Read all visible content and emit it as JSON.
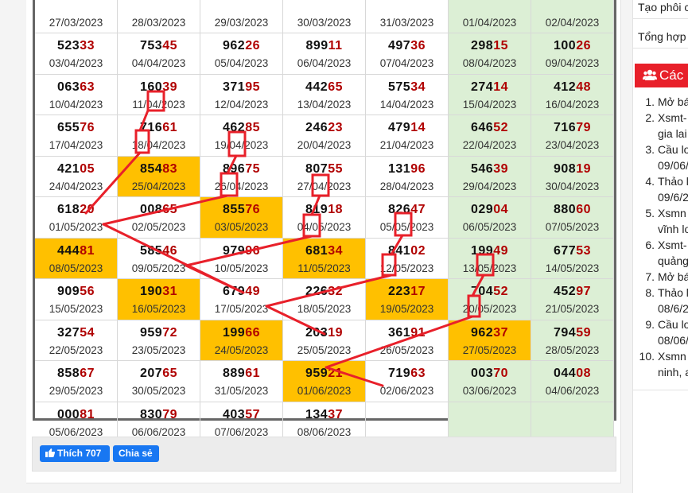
{
  "results_table": {
    "rows": [
      [
        {
          "head": "",
          "tail": "",
          "date": "27/03/2023"
        },
        {
          "head": "",
          "tail": "",
          "date": "28/03/2023"
        },
        {
          "head": "",
          "tail": "",
          "date": "29/03/2023"
        },
        {
          "head": "",
          "tail": "",
          "date": "30/03/2023"
        },
        {
          "head": "",
          "tail": "",
          "date": "31/03/2023"
        },
        {
          "head": "",
          "tail": "",
          "date": "01/04/2023"
        },
        {
          "head": "",
          "tail": "",
          "date": "02/04/2023"
        }
      ],
      [
        {
          "head": "523",
          "tail": "33",
          "date": "03/04/2023"
        },
        {
          "head": "753",
          "tail": "45",
          "date": "04/04/2023"
        },
        {
          "head": "962",
          "tail": "26",
          "date": "05/04/2023"
        },
        {
          "head": "899",
          "tail": "11",
          "date": "06/04/2023"
        },
        {
          "head": "497",
          "tail": "36",
          "date": "07/04/2023"
        },
        {
          "head": "298",
          "tail": "15",
          "date": "08/04/2023"
        },
        {
          "head": "100",
          "tail": "26",
          "date": "09/04/2023"
        }
      ],
      [
        {
          "head": "063",
          "tail": "63",
          "date": "10/04/2023"
        },
        {
          "head": "160",
          "tail": "39",
          "date": "11/04/2023"
        },
        {
          "head": "371",
          "tail": "95",
          "date": "12/04/2023"
        },
        {
          "head": "442",
          "tail": "65",
          "date": "13/04/2023"
        },
        {
          "head": "575",
          "tail": "34",
          "date": "14/04/2023"
        },
        {
          "head": "274",
          "tail": "14",
          "date": "15/04/2023"
        },
        {
          "head": "412",
          "tail": "48",
          "date": "16/04/2023"
        }
      ],
      [
        {
          "head": "655",
          "tail": "76",
          "date": "17/04/2023"
        },
        {
          "head": "716",
          "tail": "61",
          "date": "18/04/2023"
        },
        {
          "head": "462",
          "tail": "85",
          "date": "19/04/2023"
        },
        {
          "head": "246",
          "tail": "23",
          "date": "20/04/2023"
        },
        {
          "head": "479",
          "tail": "14",
          "date": "21/04/2023"
        },
        {
          "head": "646",
          "tail": "52",
          "date": "22/04/2023"
        },
        {
          "head": "716",
          "tail": "79",
          "date": "23/04/2023"
        }
      ],
      [
        {
          "head": "421",
          "tail": "05",
          "date": "24/04/2023"
        },
        {
          "head": "854",
          "tail": "83",
          "date": "25/04/2023"
        },
        {
          "head": "896",
          "tail": "75",
          "date": "26/04/2023"
        },
        {
          "head": "807",
          "tail": "55",
          "date": "27/04/2023"
        },
        {
          "head": "131",
          "tail": "96",
          "date": "28/04/2023"
        },
        {
          "head": "546",
          "tail": "39",
          "date": "29/04/2023"
        },
        {
          "head": "908",
          "tail": "19",
          "date": "30/04/2023"
        }
      ],
      [
        {
          "head": "618",
          "tail": "20",
          "date": "01/05/2023"
        },
        {
          "head": "008",
          "tail": "65",
          "date": "02/05/2023"
        },
        {
          "head": "855",
          "tail": "76",
          "date": "03/05/2023"
        },
        {
          "head": "819",
          "tail": "18",
          "date": "04/05/2023"
        },
        {
          "head": "826",
          "tail": "47",
          "date": "05/05/2023"
        },
        {
          "head": "029",
          "tail": "04",
          "date": "06/05/2023"
        },
        {
          "head": "880",
          "tail": "60",
          "date": "07/05/2023"
        }
      ],
      [
        {
          "head": "444",
          "tail": "81",
          "date": "08/05/2023"
        },
        {
          "head": "585",
          "tail": "46",
          "date": "09/05/2023"
        },
        {
          "head": "979",
          "tail": "96",
          "date": "10/05/2023"
        },
        {
          "head": "681",
          "tail": "34",
          "date": "11/05/2023"
        },
        {
          "head": "841",
          "tail": "02",
          "date": "12/05/2023"
        },
        {
          "head": "199",
          "tail": "49",
          "date": "13/05/2023"
        },
        {
          "head": "677",
          "tail": "53",
          "date": "14/05/2023"
        }
      ],
      [
        {
          "head": "909",
          "tail": "56",
          "date": "15/05/2023"
        },
        {
          "head": "190",
          "tail": "31",
          "date": "16/05/2023"
        },
        {
          "head": "679",
          "tail": "49",
          "date": "17/05/2023"
        },
        {
          "head": "226",
          "tail": "32",
          "date": "18/05/2023"
        },
        {
          "head": "223",
          "tail": "17",
          "date": "19/05/2023"
        },
        {
          "head": "704",
          "tail": "52",
          "date": "20/05/2023"
        },
        {
          "head": "452",
          "tail": "97",
          "date": "21/05/2023"
        }
      ],
      [
        {
          "head": "327",
          "tail": "54",
          "date": "22/05/2023"
        },
        {
          "head": "959",
          "tail": "72",
          "date": "23/05/2023"
        },
        {
          "head": "199",
          "tail": "66",
          "date": "24/05/2023"
        },
        {
          "head": "203",
          "tail": "19",
          "date": "25/05/2023"
        },
        {
          "head": "361",
          "tail": "91",
          "date": "26/05/2023"
        },
        {
          "head": "962",
          "tail": "37",
          "date": "27/05/2023"
        },
        {
          "head": "794",
          "tail": "59",
          "date": "28/05/2023"
        }
      ],
      [
        {
          "head": "858",
          "tail": "67",
          "date": "29/05/2023"
        },
        {
          "head": "207",
          "tail": "65",
          "date": "30/05/2023"
        },
        {
          "head": "889",
          "tail": "61",
          "date": "31/05/2023"
        },
        {
          "head": "959",
          "tail": "21",
          "date": "01/06/2023"
        },
        {
          "head": "719",
          "tail": "63",
          "date": "02/06/2023"
        },
        {
          "head": "003",
          "tail": "70",
          "date": "03/06/2023"
        },
        {
          "head": "044",
          "tail": "08",
          "date": "04/06/2023"
        }
      ],
      [
        {
          "head": "000",
          "tail": "81",
          "date": "05/06/2023"
        },
        {
          "head": "830",
          "tail": "79",
          "date": "06/06/2023"
        },
        {
          "head": "403",
          "tail": "57",
          "date": "07/06/2023"
        },
        {
          "head": "134",
          "tail": "37",
          "date": "08/06/2023"
        },
        {
          "head": "",
          "tail": "",
          "date": ""
        },
        {
          "head": "",
          "tail": "",
          "date": ""
        },
        {
          "head": "",
          "tail": "",
          "date": ""
        }
      ]
    ],
    "highlighted_dates": [
      "25/04/2023",
      "03/05/2023",
      "08/05/2023",
      "11/05/2023",
      "16/05/2023",
      "19/05/2023",
      "24/05/2023",
      "27/05/2023",
      "01/06/2023"
    ],
    "highlight_color": "#ffc000",
    "weekend_color": "#dcefd5",
    "annotation_color": "#e8202a"
  },
  "share_bar": {
    "like_label": "Thích 707",
    "share_label": "Chia sẻ",
    "button_color": "#1877f2"
  },
  "sidebar": {
    "links": [
      "Tạo phôi c",
      "Tổng hợp"
    ],
    "header": "Các",
    "header_color": "#e8202a",
    "items": [
      {
        "index": "1.",
        "lines": [
          "Mở bá"
        ]
      },
      {
        "index": "2.",
        "lines": [
          "Xsmt-",
          "gia lai"
        ]
      },
      {
        "index": "3.",
        "lines": [
          "Cầu lo",
          "09/06/"
        ]
      },
      {
        "index": "4.",
        "lines": [
          "Thảo l",
          "09/6/2"
        ]
      },
      {
        "index": "5.",
        "lines": [
          "Xsmn",
          "vĩnh lo"
        ]
      },
      {
        "index": "6.",
        "lines": [
          "Xsmt-",
          "quảng"
        ]
      },
      {
        "index": "7.",
        "lines": [
          "Mở bá"
        ]
      },
      {
        "index": "8.",
        "lines": [
          "Thảo l",
          "08/6/2"
        ]
      },
      {
        "index": "9.",
        "lines": [
          "Cầu lo",
          "08/06/"
        ]
      },
      {
        "index": "10.",
        "lines": [
          "Xsmn",
          "ninh, a"
        ]
      }
    ]
  }
}
